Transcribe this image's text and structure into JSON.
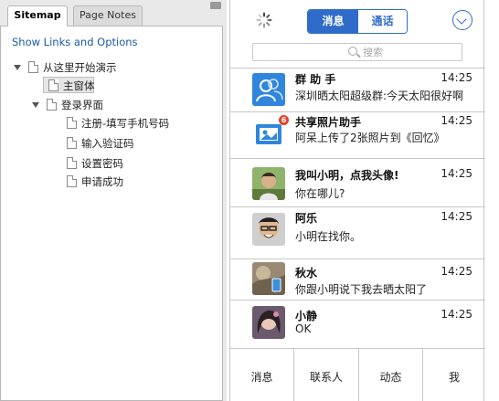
{
  "sidebar": {
    "tabs": [
      {
        "label": "Sitemap"
      },
      {
        "label": "Page Notes"
      }
    ],
    "links_options": "Show Links and Options",
    "tree": [
      {
        "label": "从这里开始演示"
      },
      {
        "label": "主窗体"
      },
      {
        "label": "登录界面"
      },
      {
        "label": "注册-填写手机号码"
      },
      {
        "label": "输入验证码"
      },
      {
        "label": "设置密码"
      },
      {
        "label": "申请成功"
      }
    ]
  },
  "phone": {
    "segments": {
      "messages": "消息",
      "calls": "通话"
    },
    "search_placeholder": "搜索",
    "conversations": [
      {
        "name": "群 助 手",
        "time": "14:25",
        "message": "深圳晒太阳超级群:今天太阳很好啊",
        "avatar": "group-assistant-icon"
      },
      {
        "name": "共享照片助手",
        "time": "14:25",
        "message": "阿呆上传了2张照片到《回忆》",
        "avatar": "shared-photo-icon",
        "badge": "6"
      },
      {
        "name": "我叫小明，点我头像!",
        "time": "14:25",
        "message": "你在哪儿?",
        "avatar": "photo-avatar"
      },
      {
        "name": "阿乐",
        "time": "14:25",
        "message": "小明在找你。",
        "avatar": "photo-avatar"
      },
      {
        "name": "秋水",
        "time": "14:25",
        "message": "你跟小明说下我去晒太阳了",
        "avatar": "photo-avatar"
      },
      {
        "name": "小静",
        "time": "14:25",
        "message": "OK",
        "avatar": "photo-avatar"
      }
    ],
    "bottom_tabs": [
      {
        "label": "消息"
      },
      {
        "label": "联系人"
      },
      {
        "label": "动态"
      },
      {
        "label": "我"
      }
    ]
  },
  "colors": {
    "accent": "#2f6cc9",
    "badge": "#e6412b"
  }
}
